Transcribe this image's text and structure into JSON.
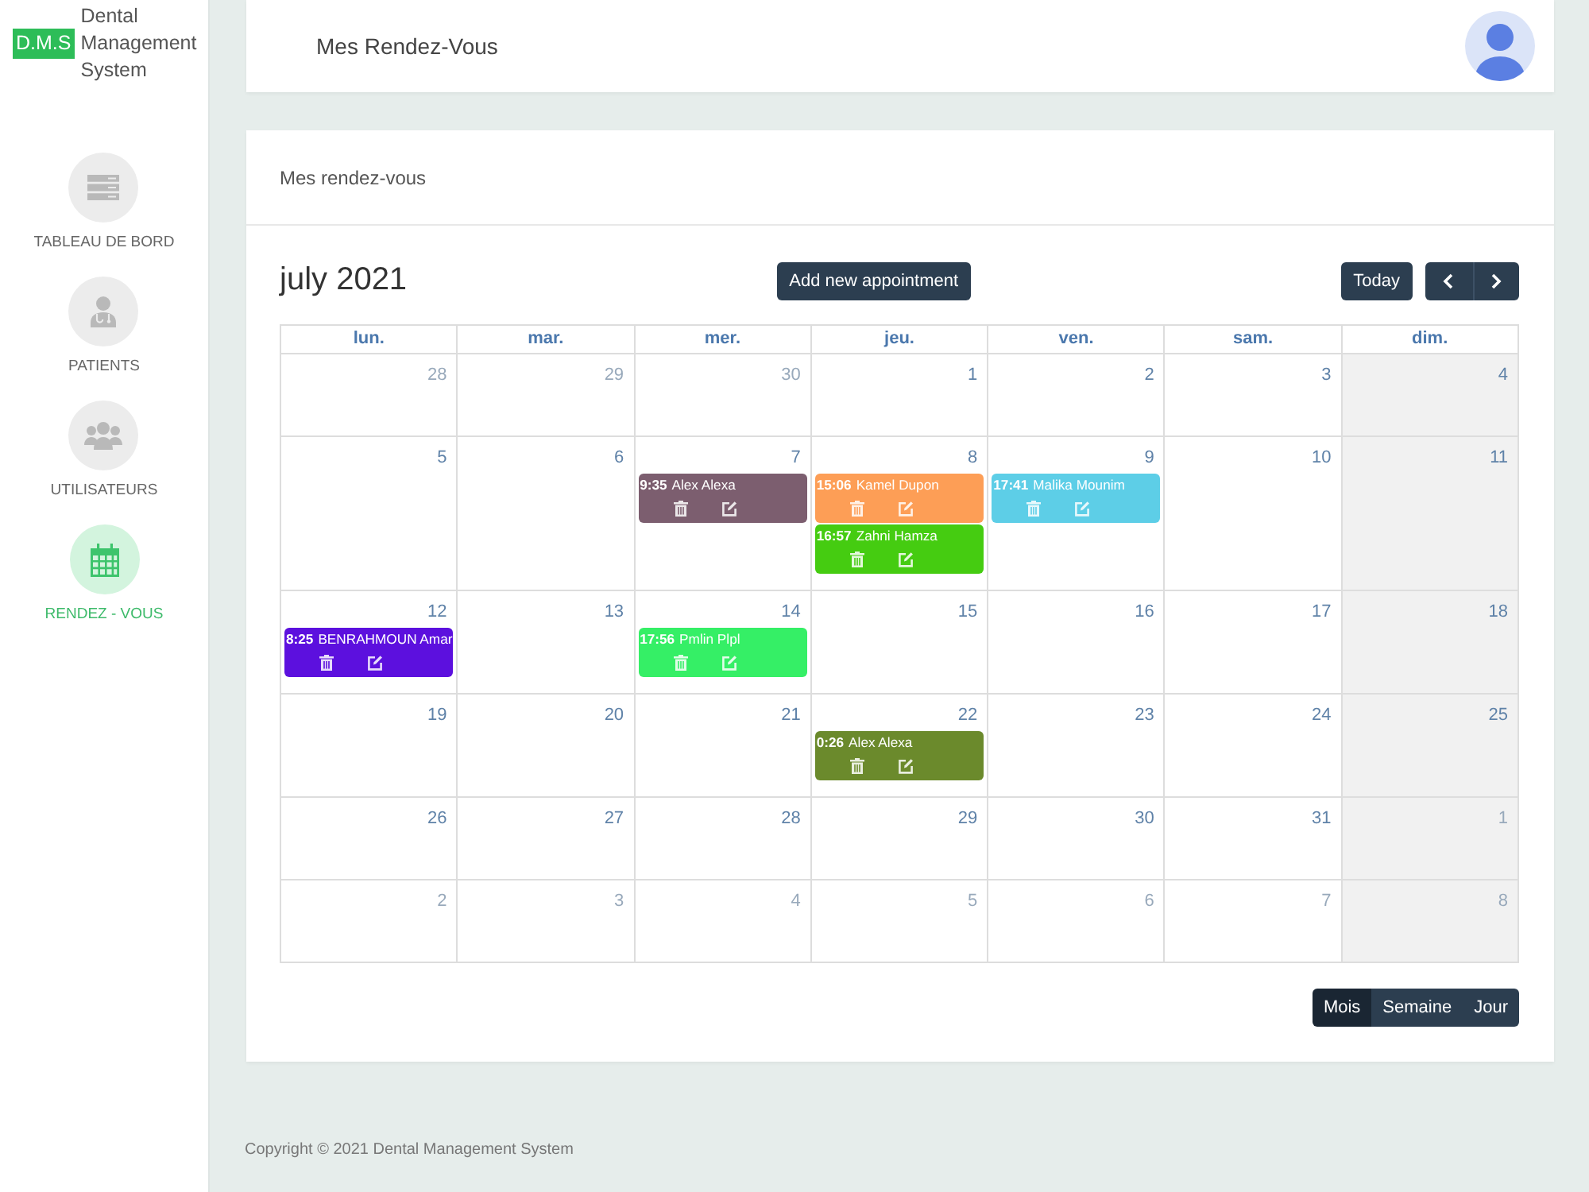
{
  "brand": {
    "badge": "D.M.S",
    "name": "Dental Management System"
  },
  "sidebar": {
    "items": [
      {
        "kind": "stack",
        "label": "TABLEAU DE BORD",
        "selected": false
      },
      {
        "kind": "doctor",
        "label": "PATIENTS",
        "selected": false
      },
      {
        "kind": "group",
        "label": "UTILISATEURS",
        "selected": false
      },
      {
        "kind": "calendar",
        "label": "RENDEZ - VOUS",
        "selected": true
      }
    ]
  },
  "header": {
    "title": "Mes Rendez-Vous"
  },
  "panel": {
    "title": "Mes rendez-vous"
  },
  "calendar": {
    "title": "july 2021",
    "add_button": "Add new appointment",
    "today_button": "Today",
    "weekdays": [
      {
        "label": "lun.",
        "shaded": false
      },
      {
        "label": "mar.",
        "shaded": false
      },
      {
        "label": "mer.",
        "shaded": false
      },
      {
        "label": "jeu.",
        "shaded": false
      },
      {
        "label": "ven.",
        "shaded": false
      },
      {
        "label": "sam.",
        "shaded": false
      },
      {
        "label": "dim.",
        "shaded": true
      }
    ],
    "weeks": [
      {
        "days": [
          {
            "day": "28",
            "other_month": true
          },
          {
            "day": "29",
            "other_month": true
          },
          {
            "day": "30",
            "other_month": true
          },
          {
            "day": "1",
            "other_month": false
          },
          {
            "day": "2",
            "other_month": false
          },
          {
            "day": "3",
            "other_month": false
          },
          {
            "day": "4",
            "other_month": false
          }
        ]
      },
      {
        "days": [
          {
            "day": "5",
            "other_month": false
          },
          {
            "day": "6",
            "other_month": false
          },
          {
            "day": "7",
            "other_month": false,
            "events": [
              {
                "time": "9:35",
                "name": "Alex Alexa",
                "color": "#7c5e6f"
              }
            ]
          },
          {
            "day": "8",
            "other_month": false,
            "events": [
              {
                "time": "15:06",
                "name": "Kamel Dupon",
                "color": "#fd9e56"
              },
              {
                "time": "16:57",
                "name": "Zahni Hamza",
                "color": "#45cc11"
              }
            ]
          },
          {
            "day": "9",
            "other_month": false,
            "events": [
              {
                "time": "17:41",
                "name": "Malika Mounim",
                "color": "#5dcee7"
              }
            ]
          },
          {
            "day": "10",
            "other_month": false
          },
          {
            "day": "11",
            "other_month": false
          }
        ]
      },
      {
        "days": [
          {
            "day": "12",
            "other_month": false,
            "events": [
              {
                "time": "8:25",
                "name": "BENRAHMOUN Amar",
                "color": "#5c10de"
              }
            ]
          },
          {
            "day": "13",
            "other_month": false
          },
          {
            "day": "14",
            "other_month": false,
            "events": [
              {
                "time": "17:56",
                "name": "Pmlin Plpl",
                "color": "#35ef66"
              }
            ]
          },
          {
            "day": "15",
            "other_month": false
          },
          {
            "day": "16",
            "other_month": false
          },
          {
            "day": "17",
            "other_month": false
          },
          {
            "day": "18",
            "other_month": false
          }
        ]
      },
      {
        "days": [
          {
            "day": "19",
            "other_month": false
          },
          {
            "day": "20",
            "other_month": false
          },
          {
            "day": "21",
            "other_month": false
          },
          {
            "day": "22",
            "other_month": false,
            "events": [
              {
                "time": "0:26",
                "name": "Alex Alexa",
                "color": "#6b8a2c"
              }
            ]
          },
          {
            "day": "23",
            "other_month": false
          },
          {
            "day": "24",
            "other_month": false
          },
          {
            "day": "25",
            "other_month": false
          }
        ]
      },
      {
        "days": [
          {
            "day": "26",
            "other_month": false
          },
          {
            "day": "27",
            "other_month": false
          },
          {
            "day": "28",
            "other_month": false
          },
          {
            "day": "29",
            "other_month": false
          },
          {
            "day": "30",
            "other_month": false
          },
          {
            "day": "31",
            "other_month": false
          },
          {
            "day": "1",
            "other_month": true
          }
        ]
      },
      {
        "days": [
          {
            "day": "2",
            "other_month": true
          },
          {
            "day": "3",
            "other_month": true
          },
          {
            "day": "4",
            "other_month": true
          },
          {
            "day": "5",
            "other_month": true
          },
          {
            "day": "6",
            "other_month": true
          },
          {
            "day": "7",
            "other_month": true
          },
          {
            "day": "8",
            "other_month": true
          }
        ]
      }
    ],
    "views": [
      {
        "label": "Mois",
        "selected": true
      },
      {
        "label": "Semaine",
        "selected": false
      },
      {
        "label": "Jour",
        "selected": false
      }
    ]
  },
  "footer": {
    "text": "Copyright © 2021 Dental Management System"
  }
}
